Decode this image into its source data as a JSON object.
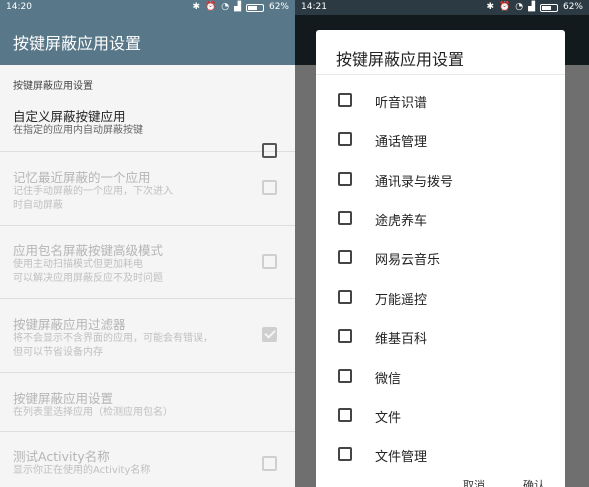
{
  "left": {
    "status": {
      "time": "14:20",
      "battery": "62%",
      "battery_level": 0.62
    },
    "title": "按键屏蔽应用设置",
    "category": "按键屏蔽应用设置",
    "prefs": [
      {
        "title": "自定义屏蔽按键应用",
        "summary_1": "在指定的应用内自动屏蔽按键",
        "summary_2": "",
        "checked": false,
        "enabled": true
      },
      {
        "title": "记忆最近屏蔽的一个应用",
        "summary_1": "记住手动屏蔽的一个应用，下次进入",
        "summary_2": "时自动屏蔽",
        "checked": false,
        "enabled": false
      },
      {
        "title": "应用包名屏蔽按键高级模式",
        "summary_1": "使用主动扫描模式但更加耗电",
        "summary_2": "可以解决应用屏蔽反应不及时问题",
        "checked": false,
        "enabled": false
      },
      {
        "title": "按键屏蔽应用过滤器",
        "summary_1": "将不会显示不含界面的应用，可能会有错误，",
        "summary_2": "但可以节省设备内存",
        "checked": true,
        "enabled": false
      },
      {
        "title": "按键屏蔽应用设置",
        "summary_1": "在列表里选择应用（检测应用包名）",
        "summary_2": "",
        "checked": false,
        "enabled": false
      },
      {
        "title": "测试Activity名称",
        "summary_1": "显示你正在使用的Activity名称",
        "summary_2": "",
        "checked": false,
        "enabled": false
      }
    ]
  },
  "right": {
    "status": {
      "time": "14:21",
      "battery": "62%",
      "battery_level": 0.62
    },
    "dialog": {
      "title": "按键屏蔽应用设置",
      "options": [
        "听音识谱",
        "通话管理",
        "通讯录与拨号",
        "途虎养车",
        "网易云音乐",
        "万能遥控",
        "维基百科",
        "微信",
        "文件",
        "文件管理"
      ],
      "cancel_label": "取消",
      "ok_label": "确认"
    }
  }
}
